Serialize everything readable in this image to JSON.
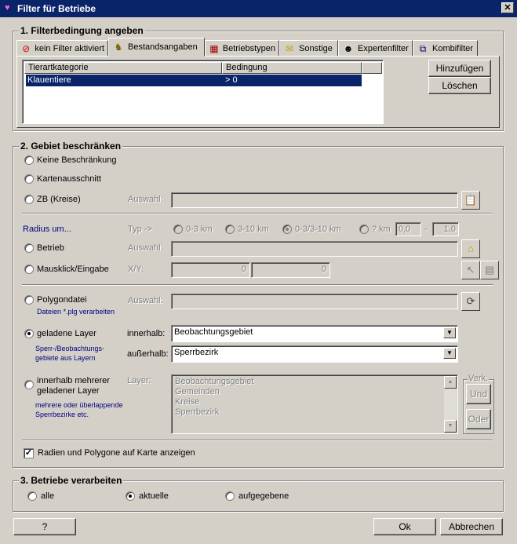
{
  "window": {
    "title": "Filter für Betriebe",
    "close_label": "✕"
  },
  "section1": {
    "label": "1. Filterbedingung angeben",
    "tabs": [
      {
        "label": "kein Filter aktiviert",
        "icon": "no-entry-icon"
      },
      {
        "label": "Bestandsangaben",
        "icon": "cow-icon"
      },
      {
        "label": "Betriebstypen",
        "icon": "calendar-icon"
      },
      {
        "label": "Sonstige",
        "icon": "envelope-icon"
      },
      {
        "label": "Expertenfilter",
        "icon": "person-icon"
      },
      {
        "label": "Kombifilter",
        "icon": "network-icon"
      }
    ],
    "table": {
      "headers": [
        "Tierartkategorie",
        "Bedingung"
      ],
      "rows": [
        {
          "kategorie": "Klauentiere",
          "bedingung": "> 0"
        }
      ]
    },
    "add_button": "Hinzufügen",
    "delete_button": "Löschen"
  },
  "section2": {
    "label": "2. Gebiet beschränken",
    "keine": "Keine Beschränkung",
    "karten": "Kartenausschnitt",
    "zb": "ZB (Kreise)",
    "auswahl": "Auswahl:",
    "radius_label": "Radius um...",
    "typ_label": "Typ ->",
    "typ_options": [
      "0-3 km",
      "3-10 km",
      "0-3/3-10 km",
      "? km"
    ],
    "km_from": "0,0",
    "km_dash": "-",
    "km_to": "1,0",
    "betrieb": "Betrieb",
    "mausklick": "Mausklick/Eingabe",
    "xy_label": "X/Y:",
    "x_value": "0",
    "y_value": "0",
    "polygon": "Polygondatei",
    "polygon_hint": "Dateien *.plg verarbeiten",
    "geladene": "geladene Layer",
    "geladene_hint": "Sperr-/Beobachtungs-\ngebiete aus Layern",
    "innerhalb_label": "innerhalb:",
    "innerhalb_value": "Beobachtungsgebiet",
    "ausserhalb_label": "außerhalb:",
    "ausserhalb_value": "Sperrbezirk",
    "mehrere": "innerhalb mehrerer\ngeladener Layer",
    "mehrere_hint": "mehrere oder überlappende\nSperrbezirke etc.",
    "layer_label": "Layer:",
    "layers": [
      "Beobachtungsgebiet",
      "Gemeinden",
      "Kreise",
      "Sperrbezirk"
    ],
    "verk_label": "Verk.",
    "und": "Und",
    "oder": "Oder",
    "show_check": "Radien und Polygone auf Karte anzeigen"
  },
  "section3": {
    "label": "3. Betriebe verarbeiten",
    "options": [
      "alle",
      "aktuelle",
      "aufgegebene"
    ]
  },
  "footer": {
    "help": "?",
    "ok": "Ok",
    "cancel": "Abbrechen"
  }
}
